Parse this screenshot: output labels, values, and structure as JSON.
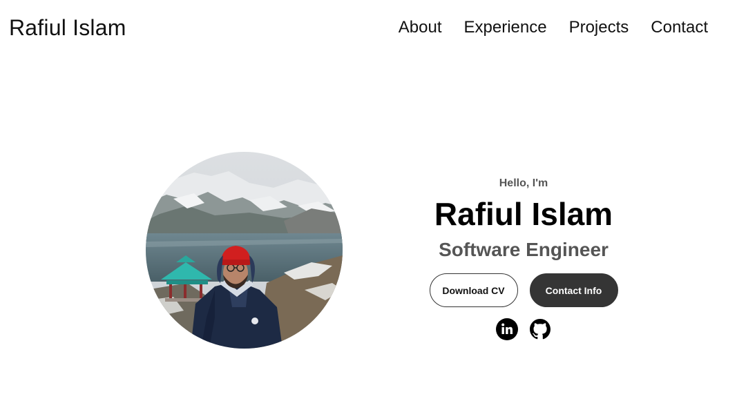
{
  "header": {
    "logo": "Rafiul Islam",
    "nav": [
      {
        "label": "About"
      },
      {
        "label": "Experience"
      },
      {
        "label": "Projects"
      },
      {
        "label": "Contact"
      }
    ]
  },
  "profile": {
    "image_alt": "Rafiul Islam profile picture"
  },
  "hero": {
    "greeting": "Hello, I'm",
    "name": "Rafiul Islam",
    "title": "Software Engineer",
    "buttons": {
      "download_cv": "Download CV",
      "contact_info": "Contact Info"
    },
    "socials": [
      {
        "icon": "linkedin-icon"
      },
      {
        "icon": "github-icon"
      }
    ]
  },
  "colors": {
    "text": "#000000",
    "muted": "#555555",
    "button_dark": "#353535",
    "background": "#ffffff"
  }
}
